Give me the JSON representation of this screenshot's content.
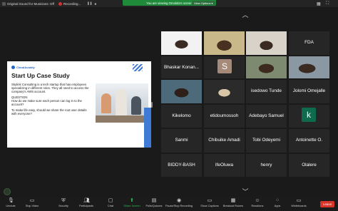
{
  "topbar": {
    "original_sound": "Original Sound for Musicians: Off",
    "recording": "Recording...",
    "share_banner": "You are viewing Omolola's screen",
    "view_options": "View Options"
  },
  "slide": {
    "logo": "CloudAcaddy",
    "title": "Start Up Case Study",
    "para1": "Skylink Consulting is a tech startup that has employees specializing in different roles. They all need to access the company's AWS account.",
    "question_label": "QUESTION",
    "question": "How do we make sure each person can log in to the account?",
    "para2": "To make life easy, should we share the root user details with everyone?"
  },
  "participants": [
    {
      "name": "",
      "tile": "video"
    },
    {
      "name": "",
      "tile": "video"
    },
    {
      "name": "",
      "tile": "video"
    },
    {
      "name": "FDA",
      "tile": "name"
    },
    {
      "name": "Bhaskar Konan...",
      "tile": "name"
    },
    {
      "name": "",
      "tile": "avatar",
      "initial": "S"
    },
    {
      "name": "",
      "tile": "video"
    },
    {
      "name": "",
      "tile": "video"
    },
    {
      "name": "",
      "tile": "video"
    },
    {
      "name": "",
      "tile": "video"
    },
    {
      "name": "isedowo Tunde",
      "tile": "name"
    },
    {
      "name": "Jolomi Omejalle",
      "tile": "name"
    },
    {
      "name": "Kikelomo",
      "tile": "name"
    },
    {
      "name": "etidoumossoh",
      "tile": "name"
    },
    {
      "name": "Adebayo Samuel",
      "tile": "name"
    },
    {
      "name": "",
      "tile": "avatar",
      "initial": "k"
    },
    {
      "name": "Sanmi",
      "tile": "name"
    },
    {
      "name": "Chibuike Amadi",
      "tile": "name"
    },
    {
      "name": "Tobi Odeyemi",
      "tile": "name"
    },
    {
      "name": "Antoinette O.",
      "tile": "name"
    },
    {
      "name": "BIDDY-BASH",
      "tile": "name"
    },
    {
      "name": "IfeOluwa",
      "tile": "name"
    },
    {
      "name": "henry",
      "tile": "name"
    },
    {
      "name": "Olalere",
      "tile": "name"
    }
  ],
  "toolbar": {
    "items": [
      {
        "label": "Unmute",
        "icon": "microphone-icon"
      },
      {
        "label": "Stop Video",
        "icon": "video-camera-icon"
      },
      {
        "label": "Security",
        "icon": "shield-icon"
      },
      {
        "label": "Participants",
        "icon": "participants-icon",
        "count": "37"
      },
      {
        "label": "Chat",
        "icon": "chat-icon"
      },
      {
        "label": "Share Screen",
        "icon": "share-screen-icon"
      },
      {
        "label": "Polls/Quizzes",
        "icon": "polls-icon"
      },
      {
        "label": "Pause/Stop Recording",
        "icon": "record-icon"
      },
      {
        "label": "Show Captions",
        "icon": "captions-icon"
      },
      {
        "label": "Breakout Rooms",
        "icon": "breakout-rooms-icon"
      },
      {
        "label": "Reactions",
        "icon": "reactions-icon"
      },
      {
        "label": "Apps",
        "icon": "apps-icon"
      },
      {
        "label": "Whiteboards",
        "icon": "whiteboard-icon"
      }
    ],
    "leave": "Leave"
  },
  "colors": {
    "banner_green": "#1e8a3a",
    "accent_green": "#2bbf4e",
    "leave_red": "#d9342b",
    "slide_blue": "#3e7ad6"
  }
}
